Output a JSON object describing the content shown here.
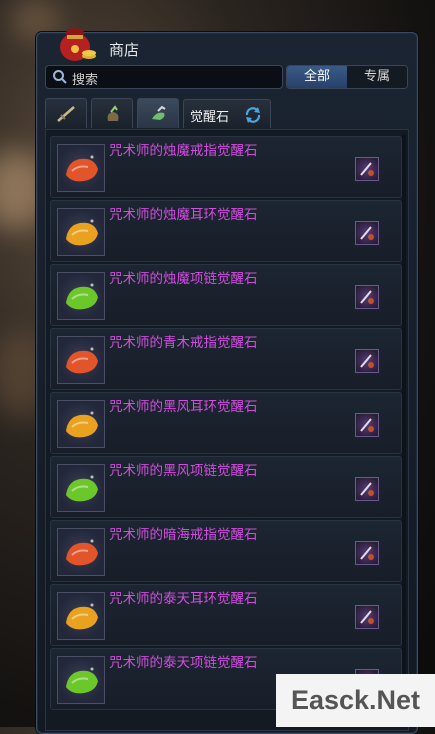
{
  "header": {
    "title": "商店"
  },
  "search": {
    "placeholder": "搜索"
  },
  "filter": {
    "all_label": "全部",
    "exclusive_label": "专属",
    "selected": "全部"
  },
  "tabs": [
    {
      "icon": "sword-icon",
      "active": false
    },
    {
      "icon": "pouch-icon",
      "active": false
    },
    {
      "icon": "gem-icon",
      "active": true
    }
  ],
  "category_tab": {
    "label": "觉醒石"
  },
  "items": [
    {
      "name": "咒术师的烛魔戒指觉醒石",
      "color": "#e2542a"
    },
    {
      "name": "咒术师的烛魔耳环觉醒石",
      "color": "#e8a21f"
    },
    {
      "name": "咒术师的烛魔项链觉醒石",
      "color": "#6cc72a"
    },
    {
      "name": "咒术师的青木戒指觉醒石",
      "color": "#e2542a"
    },
    {
      "name": "咒术师的黑风耳环觉醒石",
      "color": "#e8a21f"
    },
    {
      "name": "咒术师的黑风项链觉醒石",
      "color": "#6cc72a"
    },
    {
      "name": "咒术师的暗海戒指觉醒石",
      "color": "#e2542a"
    },
    {
      "name": "咒术师的泰天耳环觉醒石",
      "color": "#e8a21f"
    },
    {
      "name": "咒术师的泰天项链觉醒石",
      "color": "#6cc72a"
    }
  ],
  "watermark": {
    "text": "Easck.Net"
  },
  "colors": {
    "item_name": "#d24de0",
    "accent": "#3a5a86"
  }
}
